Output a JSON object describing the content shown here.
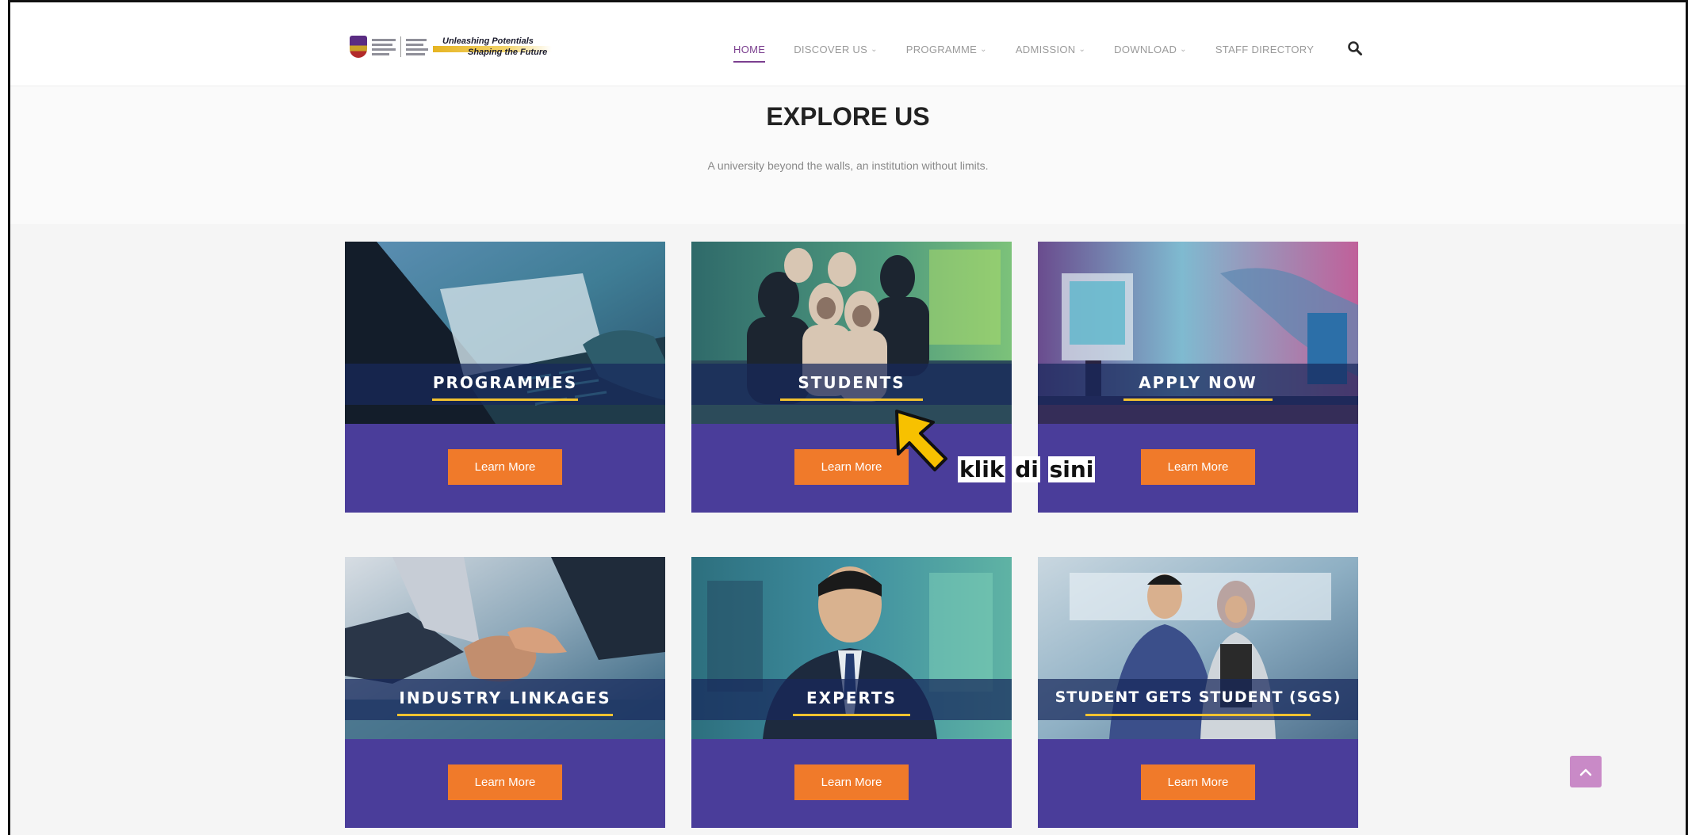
{
  "header": {
    "logo_tagline_1": "Unleashing Potentials",
    "logo_tagline_2": "Shaping the Future",
    "nav": [
      {
        "label": "HOME",
        "active": true,
        "dropdown": false
      },
      {
        "label": "DISCOVER US",
        "active": false,
        "dropdown": true
      },
      {
        "label": "PROGRAMME",
        "active": false,
        "dropdown": true
      },
      {
        "label": "ADMISSION",
        "active": false,
        "dropdown": true
      },
      {
        "label": "DOWNLOAD",
        "active": false,
        "dropdown": true
      },
      {
        "label": "STAFF DIRECTORY",
        "active": false,
        "dropdown": false
      }
    ],
    "search_icon": "search-icon"
  },
  "explore": {
    "title": "EXPLORE US",
    "subtitle": "A university beyond the walls, an institution without limits."
  },
  "cards": [
    {
      "label": "PROGRAMMES",
      "button": "Learn More"
    },
    {
      "label": "STUDENTS",
      "button": "Learn More"
    },
    {
      "label": "APPLY NOW",
      "button": "Learn More"
    },
    {
      "label": "INDUSTRY LINKAGES",
      "button": "Learn More"
    },
    {
      "label": "EXPERTS",
      "button": "Learn More"
    },
    {
      "label": "STUDENT GETS STUDENT (SGS)",
      "button": "Learn More"
    }
  ],
  "annotation": {
    "word1": "klik",
    "word2": "di",
    "word3": "sini",
    "color": "#f7c100"
  },
  "colors": {
    "card_bg": "#4a3d9a",
    "button_bg": "#f07a2a",
    "accent": "#7b3f8f",
    "underline": "#f2c230"
  }
}
